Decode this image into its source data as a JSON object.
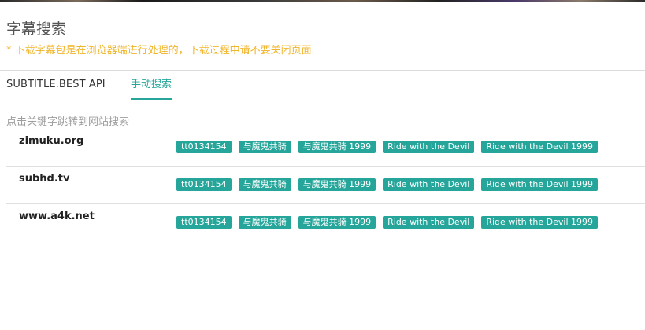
{
  "header": {
    "title": "字幕搜索",
    "warning": "* 下载字幕包是在浏览器端进行处理的，下载过程中请不要关闭页面"
  },
  "tabs": [
    {
      "label": "SUBTITLE.BEST API",
      "active": false
    },
    {
      "label": "手动搜索",
      "active": true
    }
  ],
  "accent_color": "#26a69a",
  "warning_color": "#f0b429",
  "hint": "点击关键字跳转到网站搜索",
  "sites": [
    {
      "name": "zimuku.org",
      "keywords": [
        "tt0134154",
        "与魔鬼共骑",
        "与魔鬼共骑 1999",
        "Ride with the Devil",
        "Ride with the Devil 1999"
      ]
    },
    {
      "name": "subhd.tv",
      "keywords": [
        "tt0134154",
        "与魔鬼共骑",
        "与魔鬼共骑 1999",
        "Ride with the Devil",
        "Ride with the Devil 1999"
      ]
    },
    {
      "name": "www.a4k.net",
      "keywords": [
        "tt0134154",
        "与魔鬼共骑",
        "与魔鬼共骑 1999",
        "Ride with the Devil",
        "Ride with the Devil 1999"
      ]
    }
  ]
}
